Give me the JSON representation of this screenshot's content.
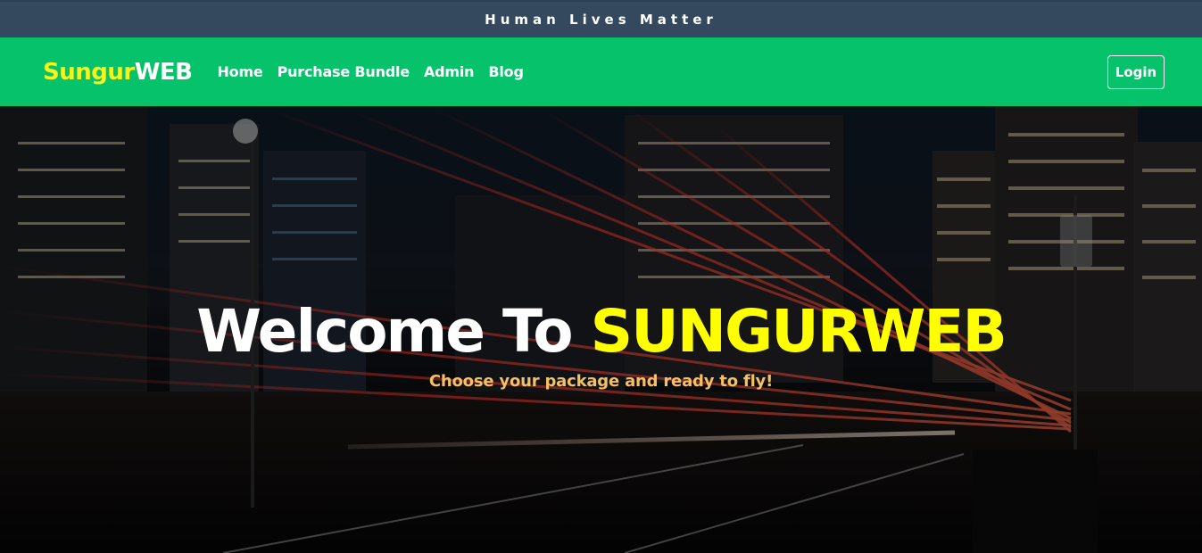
{
  "announcement": {
    "text": "Human Lives Matter"
  },
  "navbar": {
    "brand_part1": "Sungur",
    "brand_part2": "WEB",
    "links": [
      {
        "label": "Home"
      },
      {
        "label": "Purchase Bundle"
      },
      {
        "label": "Admin"
      },
      {
        "label": "Blog"
      }
    ],
    "login_label": "Login"
  },
  "hero": {
    "title_part1": "Welcome To ",
    "title_part2": "SUNGURWEB",
    "subtitle": "Choose your package and ready to fly!"
  },
  "colors": {
    "announcement_bg": "#34495e",
    "navbar_bg": "#06c36b",
    "brand_accent": "#f5f51c",
    "title_accent": "#ffff00",
    "subtitle": "#f5c063"
  }
}
